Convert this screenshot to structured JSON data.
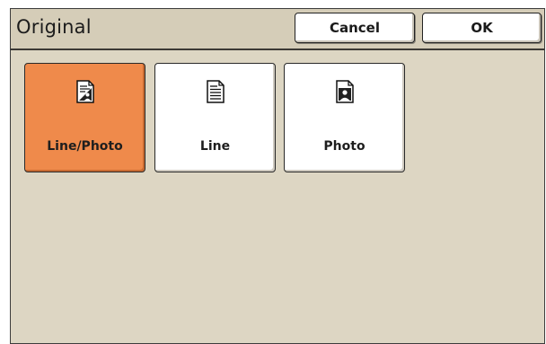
{
  "title": "Original",
  "buttons": {
    "cancel": "Cancel",
    "ok": "OK"
  },
  "options": [
    {
      "label": "Line/Photo",
      "icon": "line-photo-document-icon",
      "selected": true
    },
    {
      "label": "Line",
      "icon": "text-document-icon",
      "selected": false
    },
    {
      "label": "Photo",
      "icon": "photo-document-icon",
      "selected": false
    }
  ],
  "colors": {
    "selected": "#ef8a4b",
    "background": "#ddd6c3"
  }
}
